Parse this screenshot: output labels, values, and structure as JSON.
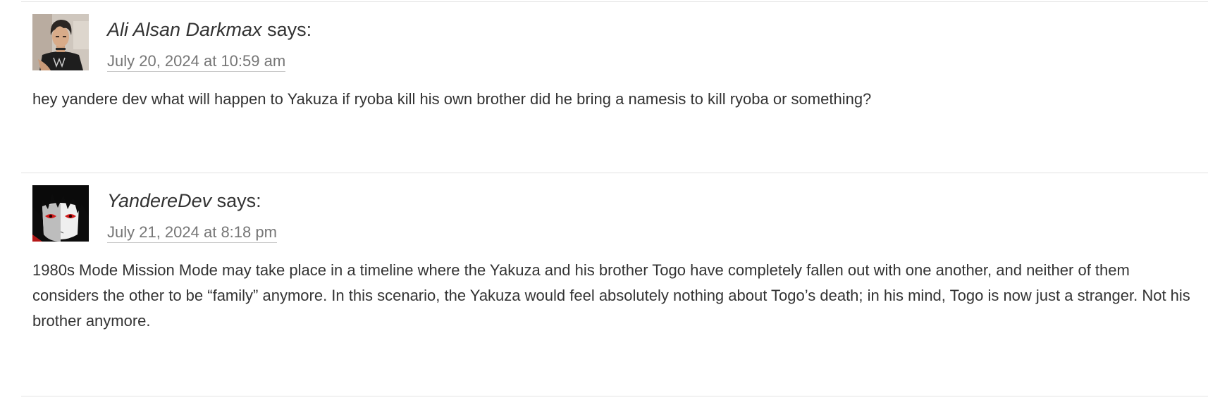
{
  "comments": [
    {
      "author": "Ali Alsan Darkmax",
      "says": "says:",
      "date": "July 20, 2024 at 10:59 am",
      "body": "hey yandere dev what will happen to Yakuza if ryoba kill his own brother did he bring a namesis to kill ryoba or something?",
      "avatar_icon": "anime-man-avatar-icon"
    },
    {
      "author": "YandereDev",
      "says": "says:",
      "date": "July 21, 2024 at 8:18 pm",
      "body": "1980s Mode Mission Mode may take place in a timeline where the Yakuza and his brother Togo have completely fallen out with one another, and neither of them considers the other to be “family” anymore. In this scenario, the Yakuza would feel absolutely nothing about Togo’s death; in his mind, Togo is now just a stranger. Not his brother anymore.",
      "avatar_icon": "red-eyed-anime-avatar-icon"
    }
  ],
  "colors": {
    "text": "#333333",
    "meta": "#767676",
    "divider": "#e3e3e3"
  }
}
